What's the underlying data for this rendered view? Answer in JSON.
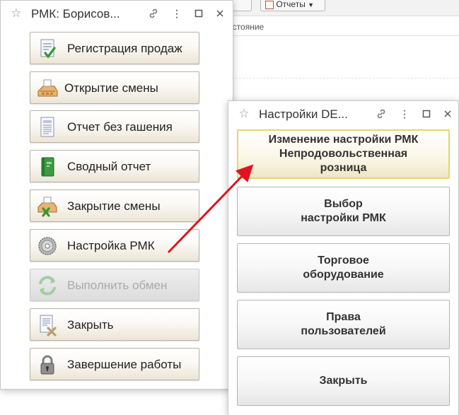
{
  "background": {
    "reports_label": "Отчеты",
    "column_header": "остояние"
  },
  "window_left": {
    "title": "РМК: Борисов...",
    "buttons": [
      {
        "label": "Регистрация продаж",
        "icon": "sales-register-icon"
      },
      {
        "label": "Открытие смены",
        "icon": "cash-register-open-icon"
      },
      {
        "label": "Отчет без гашения",
        "icon": "report-document-icon"
      },
      {
        "label": "Сводный отчет",
        "icon": "green-book-icon"
      },
      {
        "label": "Закрытие смены",
        "icon": "cash-register-close-icon"
      },
      {
        "label": "Настройка РМК",
        "icon": "disc-settings-icon"
      },
      {
        "label": "Выполнить обмен",
        "icon": "exchange-arrows-icon",
        "disabled": true
      },
      {
        "label": "Закрыть",
        "icon": "close-document-icon"
      },
      {
        "label": "Завершение работы",
        "icon": "padlock-icon"
      }
    ]
  },
  "window_right": {
    "title": "Настройки DE...",
    "buttons": [
      {
        "label": "Изменение настройки РМК\nНепродовольственная\nрозница"
      },
      {
        "label": "Выбор\nнастройки РМК"
      },
      {
        "label": "Торговое\nоборудование"
      },
      {
        "label": "Права\nпользователей"
      },
      {
        "label": "Закрыть"
      }
    ]
  },
  "colors": {
    "arrow": "#e0141e",
    "active_border": "#e8d370"
  }
}
